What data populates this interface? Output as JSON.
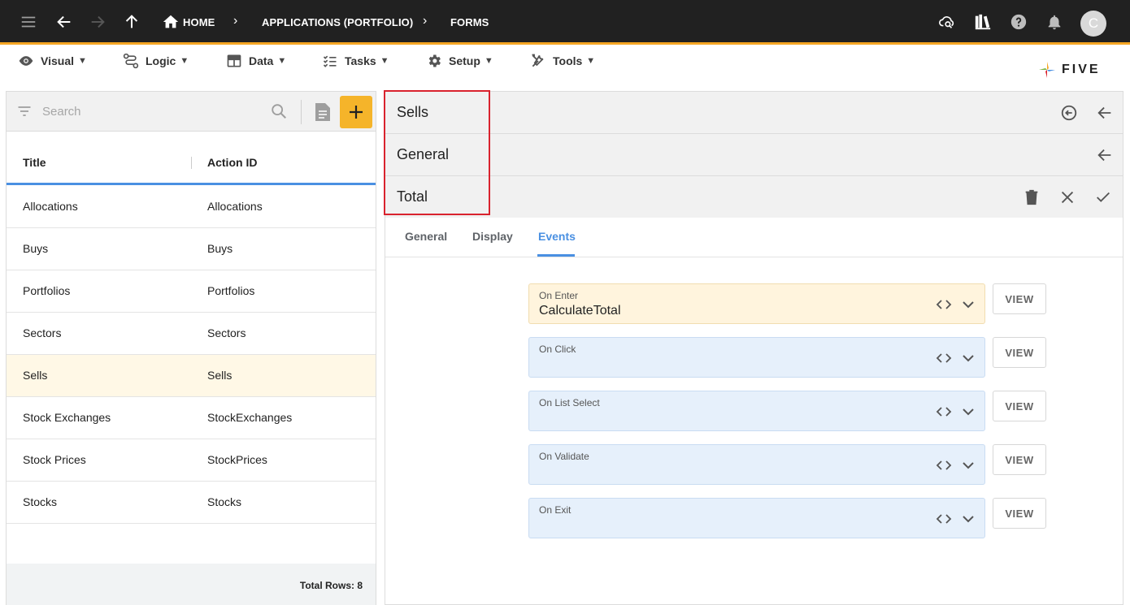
{
  "topbar": {
    "breadcrumbs": [
      "HOME",
      "APPLICATIONS (PORTFOLIO)",
      "FORMS"
    ],
    "avatar_initial": "C",
    "icons": [
      "menu-icon",
      "back-arrow-icon",
      "forward-arrow-icon",
      "up-arrow-icon",
      "home-icon",
      "cloud-search-icon",
      "library-icon",
      "help-icon",
      "notifications-icon"
    ]
  },
  "menubar": {
    "items": [
      {
        "label": "Visual",
        "icon": "eye-icon"
      },
      {
        "label": "Logic",
        "icon": "logic-icon"
      },
      {
        "label": "Data",
        "icon": "table-icon"
      },
      {
        "label": "Tasks",
        "icon": "tasks-icon"
      },
      {
        "label": "Setup",
        "icon": "gear-icon"
      },
      {
        "label": "Tools",
        "icon": "tools-icon"
      }
    ],
    "caret": "▼",
    "logo_text": "FIVE"
  },
  "list": {
    "search_placeholder": "Search",
    "columns": [
      "Title",
      "Action ID"
    ],
    "rows": [
      [
        "Allocations",
        "Allocations"
      ],
      [
        "Buys",
        "Buys"
      ],
      [
        "Portfolios",
        "Portfolios"
      ],
      [
        "Sectors",
        "Sectors"
      ],
      [
        "Sells",
        "Sells"
      ],
      [
        "Stock Exchanges",
        "StockExchanges"
      ],
      [
        "Stock Prices",
        "StockPrices"
      ],
      [
        "Stocks",
        "Stocks"
      ]
    ],
    "selected_row": "Sells",
    "footer": "Total Rows: 8"
  },
  "detail": {
    "headers": [
      "Sells",
      "General",
      "Total"
    ],
    "tabs": [
      "General",
      "Display",
      "Events"
    ],
    "active_tab": "Events",
    "events": [
      {
        "label": "On Enter",
        "value": "CalculateTotal"
      },
      {
        "label": "On Click",
        "value": ""
      },
      {
        "label": "On List Select",
        "value": ""
      },
      {
        "label": "On Validate",
        "value": ""
      },
      {
        "label": "On Exit",
        "value": ""
      }
    ],
    "view_label": "VIEW"
  },
  "colors": {
    "topbar_bg": "#212121",
    "accent_orange": "#f5a623",
    "add_button": "#f5b42a",
    "active_tab": "#4a90e2",
    "highlight_box": "#d9232e",
    "selected_row_bg": "#fff8e6"
  }
}
